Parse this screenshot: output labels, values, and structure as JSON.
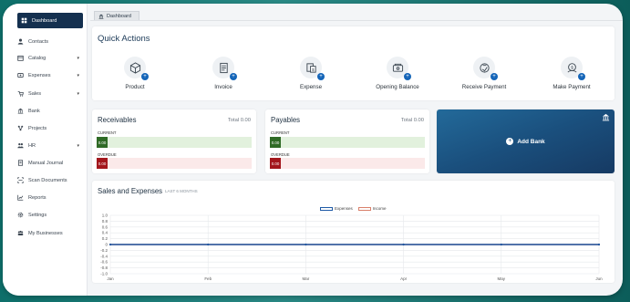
{
  "sidebar": {
    "items": [
      {
        "label": "Dashboard",
        "icon": "dashboard-icon"
      },
      {
        "label": "Contacts",
        "icon": "contacts-icon"
      },
      {
        "label": "Catalog",
        "icon": "catalog-icon",
        "caret": "▾"
      },
      {
        "label": "Expenses",
        "icon": "expenses-icon",
        "caret": "▾"
      },
      {
        "label": "Sales",
        "icon": "sales-icon",
        "caret": "▾"
      },
      {
        "label": "Bank",
        "icon": "bank-icon"
      },
      {
        "label": "Projects",
        "icon": "projects-icon"
      },
      {
        "label": "HR",
        "icon": "hr-icon",
        "caret": "▾"
      },
      {
        "label": "Manual Journal",
        "icon": "journal-icon"
      },
      {
        "label": "Scan Documents",
        "icon": "scan-icon"
      },
      {
        "label": "Reports",
        "icon": "reports-icon"
      },
      {
        "label": "Settings",
        "icon": "settings-icon"
      },
      {
        "label": "My Businesses",
        "icon": "businesses-icon"
      }
    ]
  },
  "tab": {
    "label": "Dashboard"
  },
  "quick_actions": {
    "title": "Quick Actions",
    "items": [
      {
        "label": "Product",
        "icon": "product-icon"
      },
      {
        "label": "Invoice",
        "icon": "invoice-icon"
      },
      {
        "label": "Expense",
        "icon": "expense-icon"
      },
      {
        "label": "Opening Balance",
        "icon": "opening-balance-icon"
      },
      {
        "label": "Receive Payment",
        "icon": "receive-payment-icon"
      },
      {
        "label": "Make Payment",
        "icon": "make-payment-icon"
      }
    ]
  },
  "receivables": {
    "title": "Receivables",
    "total": "Total 0.00",
    "current_label": "CURRENT",
    "current_value": "0.00",
    "overdue_label": "OVERDUE",
    "overdue_value": "0.00"
  },
  "payables": {
    "title": "Payables",
    "total": "Total 0.00",
    "current_label": "CURRENT",
    "current_value": "0.00",
    "overdue_label": "OVERDUE",
    "overdue_value": "0.00"
  },
  "add_bank": {
    "label": "Add Bank"
  },
  "sales_expenses": {
    "title": "Sales and Expenses",
    "subtitle": "LAST 6 MONTHS"
  },
  "colors": {
    "sidebar_active": "#14304f",
    "expenses_line": "#1f5aa6",
    "income_line": "#d9806b",
    "current_chip": "#2f6a25",
    "overdue_chip": "#a3161c"
  },
  "chart_data": {
    "type": "line",
    "categories": [
      "Jan",
      "Feb",
      "Mar",
      "Apr",
      "May",
      "Jun"
    ],
    "series": [
      {
        "name": "Expenses",
        "values": [
          0,
          0,
          0,
          0,
          0,
          0
        ]
      },
      {
        "name": "Income",
        "values": [
          0,
          0,
          0,
          0,
          0,
          0
        ]
      }
    ],
    "ylim": [
      -1.0,
      1.0
    ],
    "yticks": [
      "1.0",
      "0.8",
      "0.6",
      "0.4",
      "0.2",
      "0",
      "-0.2",
      "-0.4",
      "-0.6",
      "-0.8",
      "-1.0"
    ],
    "grid": true,
    "legend_position": "top-center"
  }
}
